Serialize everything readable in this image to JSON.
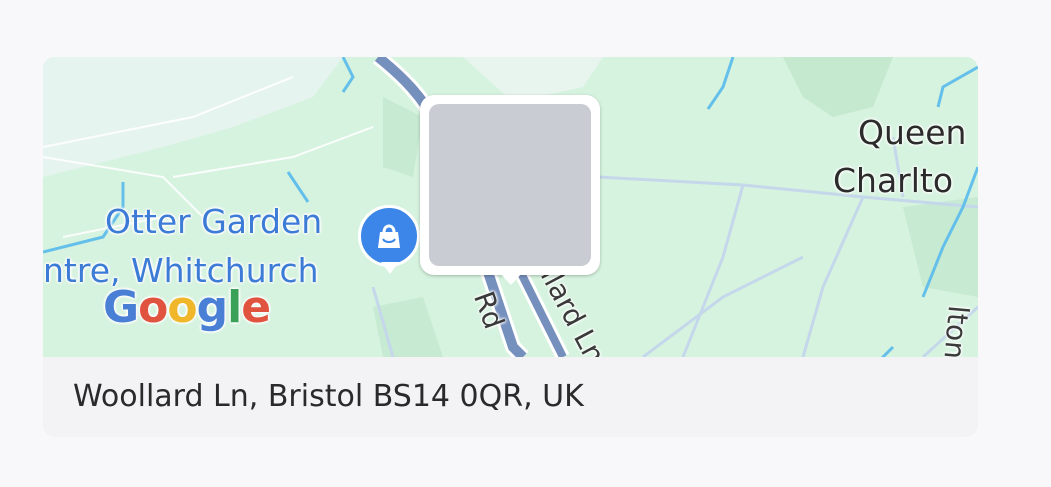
{
  "map": {
    "poi_label_line1": "Otter Garden",
    "poi_label_line2": "ntre, Whitchurch",
    "town_label_line1": "Queen",
    "town_label_line2": "Charlto",
    "road_label_1": "Rd",
    "road_label_2": "llard Ln",
    "road_label_3": "lton",
    "logo_letters": [
      "G",
      "o",
      "o",
      "g",
      "l",
      "e"
    ],
    "poi_icon": "shopping-bag-icon",
    "photo_marker": "photo-thumbnail-placeholder"
  },
  "address": "Woollard Ln, Bristol BS14 0QR, UK",
  "colors": {
    "map_background": "#d6f3df",
    "water": "#64c0ea",
    "road_major": "#7690bd",
    "poi_pin": "#3b86e8",
    "label_blue": "#3c7bd6"
  }
}
